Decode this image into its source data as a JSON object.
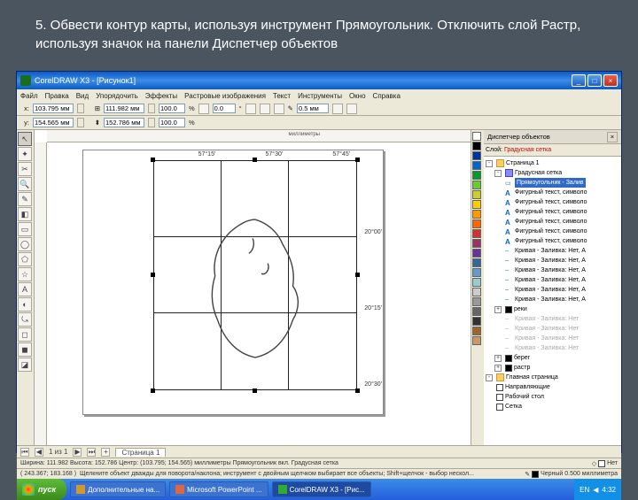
{
  "slide_caption": "5. Обвести контур карты, используя инструмент Прямоугольник. Отключить слой Растр, используя значок на панели Диспетчер объектов",
  "window_title": "CorelDRAW X3 - [Рисунок1]",
  "menu": {
    "file": "Файл",
    "edit": "Правка",
    "view": "Вид",
    "arrange": "Упорядочить",
    "effects": "Эффекты",
    "bitmaps": "Растровые изображения",
    "text": "Текст",
    "tools": "Инструменты",
    "window": "Окно",
    "help": "Справка"
  },
  "props": {
    "x": "103.795 мм",
    "y": "154.565 мм",
    "w": "111.982 мм",
    "h": "152.786 мм",
    "sx": "100.0",
    "sy": "100.0",
    "rot": "0.0",
    "outline": "0.5 мм"
  },
  "ruler_units": "миллиметры",
  "grid_labels": {
    "lon1": "57°15'",
    "lon2": "57°30'",
    "lon3": "57°45'",
    "lat1": "20°00'",
    "lat2": "20°15'",
    "lat3": "20°30'"
  },
  "objmgr": {
    "title": "Диспетчер объектов",
    "layer_label": "Слой:",
    "layer_current": "Градусная сетка",
    "page": "Страница 1",
    "items": [
      {
        "t": "Градусная сетка",
        "type": "layer",
        "sel": false
      },
      {
        "t": "Прямоугольник - Залив",
        "type": "rect",
        "sel": true
      },
      {
        "t": "Фигурный текст, символо",
        "type": "text"
      },
      {
        "t": "Фигурный текст, символо",
        "type": "text"
      },
      {
        "t": "Фигурный текст, символо",
        "type": "text"
      },
      {
        "t": "Фигурный текст, символо",
        "type": "text"
      },
      {
        "t": "Фигурный текст, символо",
        "type": "text"
      },
      {
        "t": "Фигурный текст, символо",
        "type": "text"
      },
      {
        "t": "Кривая - Заливка: Нет, А",
        "type": "curve"
      },
      {
        "t": "Кривая - Заливка: Нет, А",
        "type": "curve"
      },
      {
        "t": "Кривая - Заливка: Нет, А",
        "type": "curve"
      },
      {
        "t": "Кривая - Заливка: Нет, А",
        "type": "curve"
      },
      {
        "t": "Кривая - Заливка: Нет, А",
        "type": "curve"
      },
      {
        "t": "Кривая - Заливка: Нет, А",
        "type": "curve"
      }
    ],
    "layer_rivers": "реки",
    "disabled": [
      "Кривая - Заливка: Нет",
      "Кривая - Заливка: Нет",
      "Кривая - Заливка: Нет",
      "Кривая - Заливка: Нет"
    ],
    "layer_coast": "берег",
    "layer_raster": "растр",
    "master_page": "Главная страница",
    "guides": "Направляющие",
    "desktop": "Рабочий стол",
    "grid": "Сетка"
  },
  "tabs": {
    "count": "1 из 1",
    "page": "Страница 1"
  },
  "status": {
    "dims": "Ширина: 111.982 Высота: 152.786 Центр: (103.795; 154.565) миллиметры   Прямоугольник вкл.  Градусная сетка",
    "coords": "( 243.367; 183.168 )",
    "hint": "Щелкните объект дважды для поворота/наклона; инструмент с двойным щелчком выбирает все объекты; Shift+щелчок - выбор нескол...",
    "fill_none": "Нет",
    "outline_info": "Черный  0.500 миллиметра"
  },
  "taskbar": {
    "start": "пуск",
    "btn1": "Дополнительные на...",
    "btn2": "Microsoft PowerPoint ...",
    "btn3": "CorelDRAW X3 - [Рис...",
    "lang": "EN",
    "time": "4:32"
  },
  "colors": [
    "#ffffff",
    "#000000",
    "#003399",
    "#0066cc",
    "#009933",
    "#66cc33",
    "#cccc33",
    "#ffcc00",
    "#ff9900",
    "#ff6600",
    "#cc3333",
    "#993366",
    "#663399",
    "#336699",
    "#6699cc",
    "#99cccc",
    "#cccccc",
    "#999999",
    "#666666",
    "#333333",
    "#996633",
    "#cc9966"
  ]
}
